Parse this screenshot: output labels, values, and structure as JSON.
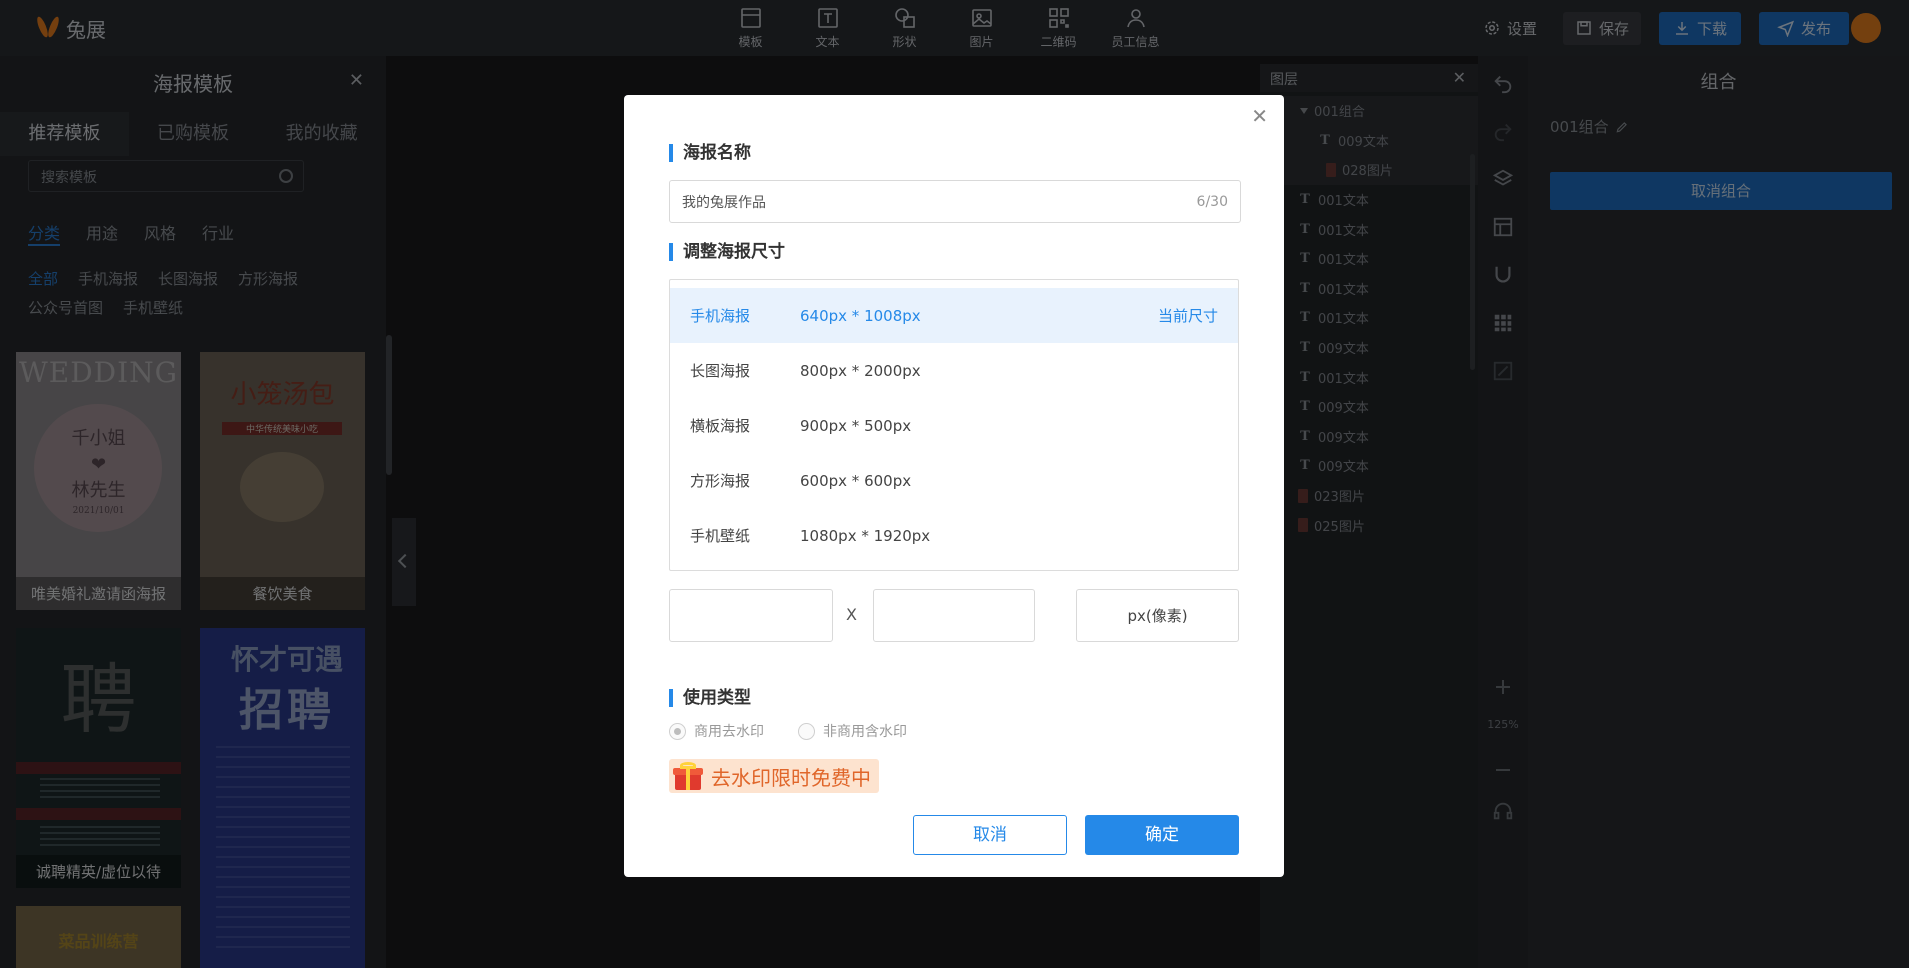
{
  "app": {
    "logo_text": "兔展"
  },
  "toolbar": {
    "tools": [
      {
        "label": "模板",
        "icon": "template-icon"
      },
      {
        "label": "文本",
        "icon": "text-icon"
      },
      {
        "label": "形状",
        "icon": "shape-icon"
      },
      {
        "label": "图片",
        "icon": "image-icon"
      },
      {
        "label": "二维码",
        "icon": "qrcode-icon"
      },
      {
        "label": "员工信息",
        "icon": "user-icon"
      }
    ],
    "settings_label": "设置",
    "save_label": "保存",
    "download_label": "下载",
    "publish_label": "发布"
  },
  "left_panel": {
    "title": "海报模板",
    "tabs": [
      "推荐模板",
      "已购模板",
      "我的收藏"
    ],
    "search_placeholder": "搜索模板",
    "categories": [
      "分类",
      "用途",
      "风格",
      "行业"
    ],
    "subcategories": [
      "全部",
      "手机海报",
      "长图海报",
      "方形海报",
      "公众号首图",
      "手机壁纸"
    ],
    "templates": [
      {
        "caption": "唯美婚礼邀请函海报",
        "art_big": "WEDDING",
        "art_line1": "千小姐",
        "art_heart": "❤",
        "art_line2": "林先生",
        "art_date": "2021/10/01"
      },
      {
        "caption": "餐饮美食",
        "art_title": "小笼汤包",
        "art_sub": "中华传统美味小吃"
      },
      {
        "caption": "诚聘精英/虚位以待",
        "art_big": "聘"
      },
      {
        "caption": "",
        "art_line1": "怀才可遇",
        "art_line2": "招聘"
      },
      {
        "caption": "",
        "art_text": "菜品训练营"
      }
    ]
  },
  "layers": {
    "title": "图层",
    "items": [
      {
        "name": "001组合",
        "kind": "group"
      },
      {
        "name": "009文本",
        "kind": "text"
      },
      {
        "name": "028图片",
        "kind": "image"
      },
      {
        "name": "001文本",
        "kind": "text"
      },
      {
        "name": "001文本",
        "kind": "text"
      },
      {
        "name": "001文本",
        "kind": "text"
      },
      {
        "name": "001文本",
        "kind": "text"
      },
      {
        "name": "001文本",
        "kind": "text"
      },
      {
        "name": "009文本",
        "kind": "text"
      },
      {
        "name": "001文本",
        "kind": "text"
      },
      {
        "name": "009文本",
        "kind": "text"
      },
      {
        "name": "009文本",
        "kind": "text"
      },
      {
        "name": "009文本",
        "kind": "text"
      },
      {
        "name": "023图片",
        "kind": "image"
      },
      {
        "name": "025图片",
        "kind": "image"
      }
    ]
  },
  "tool_strip": {
    "zoom": "125%"
  },
  "properties": {
    "title": "组合",
    "element_name": "001组合",
    "ungroup_label": "取消组合"
  },
  "modal": {
    "name_section_title": "海报名称",
    "name_value": "我的兔展作品",
    "name_count": "6/30",
    "size_section_title": "调整海报尺寸",
    "size_options": [
      {
        "name": "手机海报",
        "size": "640px * 1008px",
        "current_label": "当前尺寸",
        "selected": true
      },
      {
        "name": "长图海报",
        "size": "800px * 2000px"
      },
      {
        "name": "横板海报",
        "size": "900px * 500px"
      },
      {
        "name": "方形海报",
        "size": "600px * 600px"
      },
      {
        "name": "手机壁纸",
        "size": "1080px * 1920px"
      }
    ],
    "width_value": "",
    "height_value": "",
    "separator": "X",
    "unit_label": "px(像素)",
    "usage_section_title": "使用类型",
    "usage_options": [
      {
        "label": "商用去水印",
        "checked": true
      },
      {
        "label": "非商用含水印",
        "checked": false
      }
    ],
    "promo_text": "去水印限时免费中",
    "cancel_label": "取消",
    "confirm_label": "确定"
  }
}
